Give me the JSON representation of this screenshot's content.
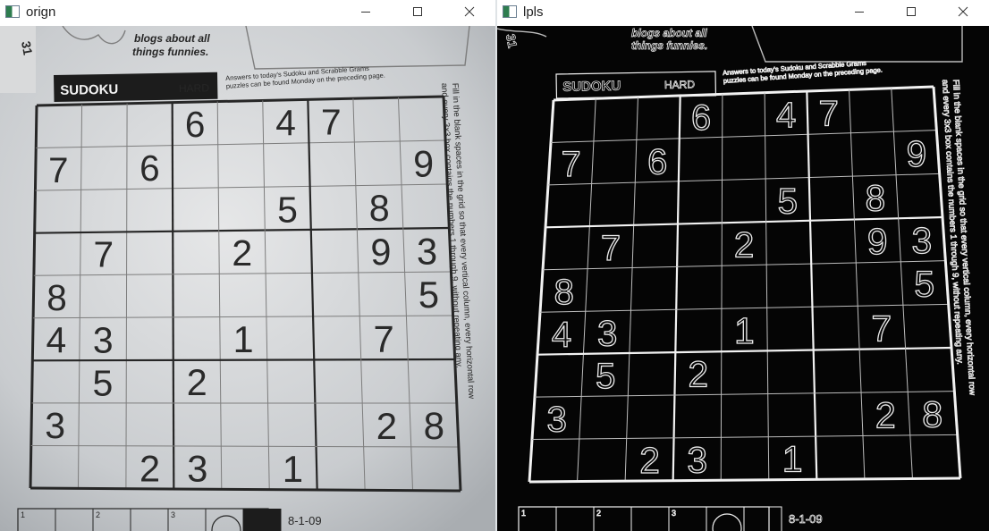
{
  "windows": [
    {
      "title": "orign",
      "mode": "photo"
    },
    {
      "title": "lpls",
      "mode": "laplacian"
    }
  ],
  "controls": {
    "minimize": "minimize",
    "maximize": "maximize",
    "close": "close"
  },
  "newspaper": {
    "top_caption_line1": "blogs about all",
    "top_caption_line2": "things funnies.",
    "page_corner_number": "31",
    "puzzle_title": "SUDOKU",
    "difficulty": "HARD",
    "answers_line1": "Answers to today's Sudoku and Scrabble Grams",
    "answers_line2": "puzzles can be found Monday on the preceding page.",
    "instructions_line1": "Fill in the blank spaces in the grid so that every vertical column, every horizontal row",
    "instructions_line2": "and every 3x3 box contains the numbers 1 through 9, without repeating any.",
    "footer_date": "8-1-09",
    "footer_cells": [
      "1",
      "2",
      "3"
    ]
  },
  "sudoku_grid": [
    [
      "",
      "",
      "",
      "6",
      "",
      "4",
      "7",
      "",
      ""
    ],
    [
      "7",
      "",
      "6",
      "",
      "",
      "",
      "",
      "",
      "9"
    ],
    [
      "",
      "",
      "",
      "",
      "",
      "5",
      "",
      "8",
      ""
    ],
    [
      "",
      "7",
      "",
      "",
      "2",
      "",
      "",
      "9",
      "3"
    ],
    [
      "8",
      "",
      "",
      "",
      "",
      "",
      "",
      "",
      "5"
    ],
    [
      "4",
      "3",
      "",
      "",
      "1",
      "",
      "",
      "7",
      ""
    ],
    [
      "",
      "5",
      "",
      "2",
      "",
      "",
      "",
      "",
      ""
    ],
    [
      "3",
      "",
      "",
      "",
      "",
      "",
      "",
      "2",
      "8"
    ],
    [
      "",
      "",
      "2",
      "3",
      "",
      "1",
      "",
      "",
      ""
    ]
  ]
}
